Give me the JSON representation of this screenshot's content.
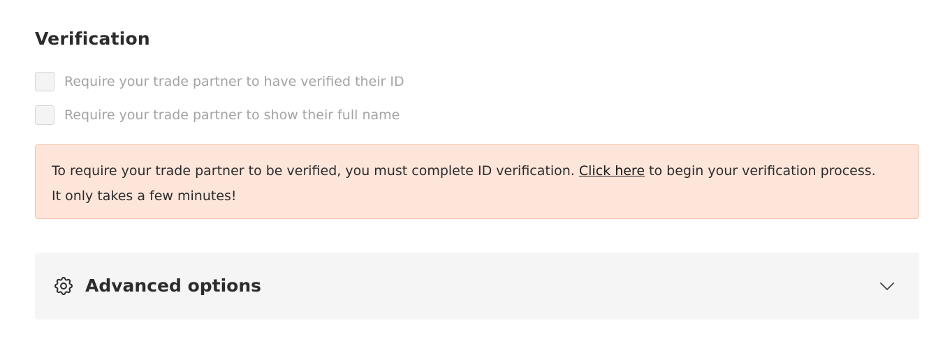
{
  "verification": {
    "title": "Verification",
    "options": [
      {
        "label": "Require your trade partner to have verified their ID",
        "checked": false,
        "disabled": true
      },
      {
        "label": "Require your trade partner to show their full name",
        "checked": false,
        "disabled": true
      }
    ],
    "notice": {
      "text_before_link": "To require your trade partner to be verified, you must complete ID verification. ",
      "link_text": "Click here",
      "text_after_link": " to begin your verification process.",
      "second_line": "It only takes a few minutes!",
      "background_color": "#fde5da",
      "border_color": "#f6c3a8"
    }
  },
  "advanced": {
    "title": "Advanced options",
    "icon": "gear-icon",
    "toggle_icon": "chevron-down-icon",
    "expanded": false
  }
}
